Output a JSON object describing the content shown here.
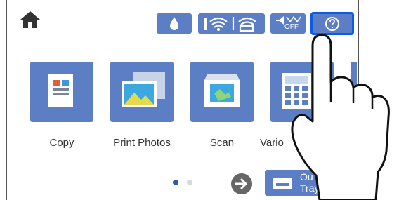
{
  "header": {
    "home_icon": "home-icon",
    "status_icons": [
      "ink-drop-icon",
      "wifi-icon",
      "wifi-direct-icon",
      "sound-off-icon",
      "help-icon"
    ],
    "sound_label": "OFF"
  },
  "tiles": [
    {
      "label": "Copy",
      "icon": "copy-icon"
    },
    {
      "label": "Print Photos",
      "icon": "photos-icon"
    },
    {
      "label": "Scan",
      "icon": "scan-icon"
    },
    {
      "label": "Vario",
      "icon": "various-icon"
    }
  ],
  "pagination": {
    "current": 1,
    "total": 2
  },
  "out_tray": {
    "line1": "Ou",
    "line2": "Tray"
  },
  "colors": {
    "tile": "#5c7ec4",
    "highlight": "#0a5ce6",
    "dot_active": "#2e5aa8",
    "dot_inactive": "#d5d9e0"
  }
}
